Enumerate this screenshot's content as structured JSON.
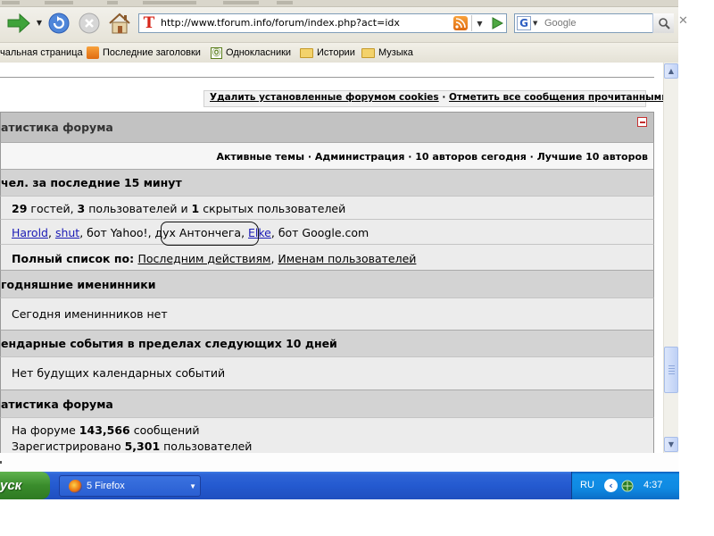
{
  "browser": {
    "url": "http://www.tforum.info/forum/index.php?act=idx",
    "search_placeholder": "Google"
  },
  "bookmarks": {
    "items": [
      {
        "label": "чальная страница",
        "icon": "page-icon"
      },
      {
        "label": "Последние заголовки",
        "icon": "rss-icon"
      },
      {
        "label": "Однокласники",
        "icon": "ok-icon"
      },
      {
        "label": "Истории",
        "icon": "folder-icon"
      },
      {
        "label": "Музыка",
        "icon": "folder-icon"
      }
    ]
  },
  "forum": {
    "cookie_link": "Удалить установленные форумом cookies",
    "cookie_sep": " · ",
    "mark_read_link": "Отметить все сообщения прочитанными",
    "board_stats_title": "атистика форума",
    "quick_links": "Активные темы · Администрация · 10 авторов сегодня · Лучшие 10 авторов",
    "online": {
      "title": "чел. за последние 15 минут",
      "guests": "29",
      "guests_label": " гостей, ",
      "users": "3",
      "users_label": " пользователей и ",
      "hidden": "1",
      "hidden_label": " скрытых пользователей",
      "user_harold": "Harold",
      "user_shut": "shut",
      "bot_yahoo": ", бот Yahoo!, ",
      "spirit": "дух Антончега",
      "sep": ", ",
      "user_elke": "Elke",
      "bot_google": ", бот Google.com",
      "full_list_label": "Полный список по: ",
      "by_last_click": "Последним действиям",
      "sep2": ", ",
      "by_member_name": "Именам пользователей"
    },
    "birthdays": {
      "title": "годняшние именинники",
      "text": "Сегодня именинников нет"
    },
    "calendar": {
      "title": "ендарные события в пределах следующих 10 дней",
      "text": "Нет будущих календарных событий"
    },
    "stats": {
      "title": "атистика форума",
      "posts_prefix": "На форуме ",
      "posts": "143,566",
      "posts_suffix": " сообщений",
      "members_prefix": "Зарегистрировано ",
      "members": "5,301",
      "members_suffix": " пользователей"
    }
  },
  "taskbar": {
    "start_label": "уск",
    "task_label": "5 Firefox",
    "lang": "RU",
    "clock": "4:37"
  }
}
